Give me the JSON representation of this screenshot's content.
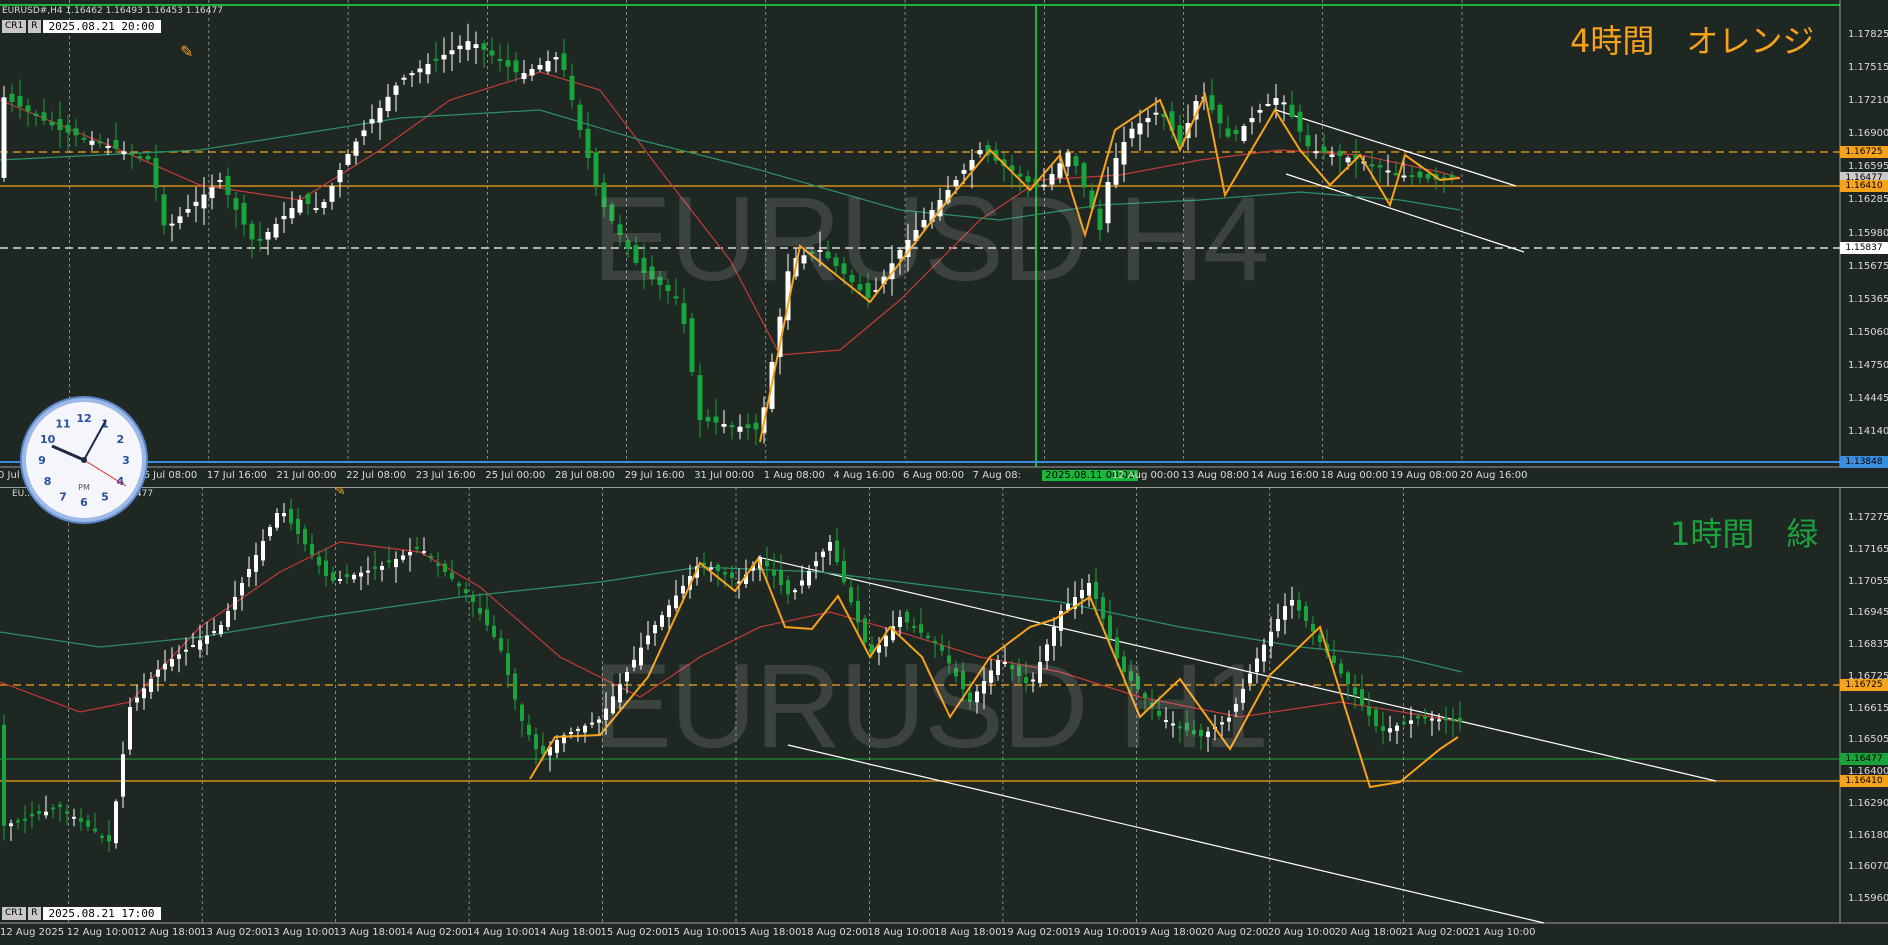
{
  "top": {
    "header": "EURUSD#,H4  1.16462 1.16493 1.16453 1.16477",
    "cr1_a": "CR1",
    "cr1_b": "R",
    "datetime": "2025.08.21 20:00",
    "watermark": "EURUSD H4",
    "note": "4時間　オレンジ",
    "note_color": "#f7a21b",
    "x_labels": [
      "0 Jul 2025",
      "15 Jul 00:00",
      "16 Jul 08:00",
      "17 Jul 16:00",
      "21 Jul 00:00",
      "22 Jul 08:00",
      "23 Jul 16:00",
      "25 Jul 00:00",
      "28 Jul 08:00",
      "29 Jul 16:00",
      "31 Jul 00:00",
      "1 Aug 08:00",
      "4 Aug 16:00",
      "6 Aug 00:00",
      "7 Aug 08:",
      "2025.08.11 00:00",
      "12 Aug 00:00",
      "13 Aug 08:00",
      "14 Aug 16:00",
      "18 Aug 00:00",
      "19 Aug 08:00",
      "20 Aug 16:00"
    ],
    "y_labels": [
      "1.17825",
      "1.17515",
      "1.17210",
      "1.16900",
      "1.16595",
      "1.16285",
      "1.15980",
      "1.15675",
      "1.15365",
      "1.15060",
      "1.14750",
      "1.14445",
      "1.14140"
    ],
    "price_tags": [
      {
        "text": "1.16725",
        "color": "#f7a21b"
      },
      {
        "text": "1.16477",
        "color": "#cccccc"
      },
      {
        "text": "1.16410",
        "color": "#f7a21b"
      },
      {
        "text": "1.15837",
        "color": "#ffffff"
      },
      {
        "text": "1.13848",
        "color": "#3b8de0"
      }
    ]
  },
  "bottom": {
    "header": "EU... 1.16493 1.16453 1.16477",
    "cr1_a": "CR1",
    "cr1_b": "R",
    "datetime": "2025.08.21 17:00",
    "watermark": "EURUSD H1",
    "note": "1時間　緑",
    "note_color": "#1aa33c",
    "x_labels": [
      "12 Aug 2025",
      "12 Aug 10:00",
      "12 Aug 18:00",
      "13 Aug 02:00",
      "13 Aug 10:00",
      "13 Aug 18:00",
      "14 Aug 02:00",
      "14 Aug 10:00",
      "14 Aug 18:00",
      "15 Aug 02:00",
      "15 Aug 10:00",
      "15 Aug 18:00",
      "18 Aug 02:00",
      "18 Aug 10:00",
      "18 Aug 18:00",
      "19 Aug 02:00",
      "19 Aug 10:00",
      "19 Aug 18:00",
      "20 Aug 02:00",
      "20 Aug 10:00",
      "20 Aug 18:00",
      "21 Aug 02:00",
      "21 Aug 10:00"
    ],
    "y_labels": [
      "1.17275",
      "1.17165",
      "1.17055",
      "1.16945",
      "1.16835",
      "1.16725",
      "1.16615",
      "1.16505",
      "1.16400",
      "1.16290",
      "1.16180",
      "1.16070",
      "1.15960"
    ],
    "price_tags": [
      {
        "text": "1.16725",
        "color": "#f7a21b"
      },
      {
        "text": "1.16477",
        "color": "#1aa33c"
      },
      {
        "text": "1.16410",
        "color": "#f7a21b"
      }
    ]
  },
  "clock": {
    "label": "PM",
    "numerals": [
      "12",
      "1",
      "2",
      "3",
      "4",
      "5",
      "6",
      "7",
      "8",
      "9",
      "10",
      "11"
    ]
  },
  "colors": {
    "background": "#1f2722",
    "bull_candle": "#ffffff",
    "bear_candle": "#1aa33c",
    "ma_red": "#c43a3a",
    "ma_green": "#2e8f6a",
    "zigzag": "#f7a21b"
  }
}
